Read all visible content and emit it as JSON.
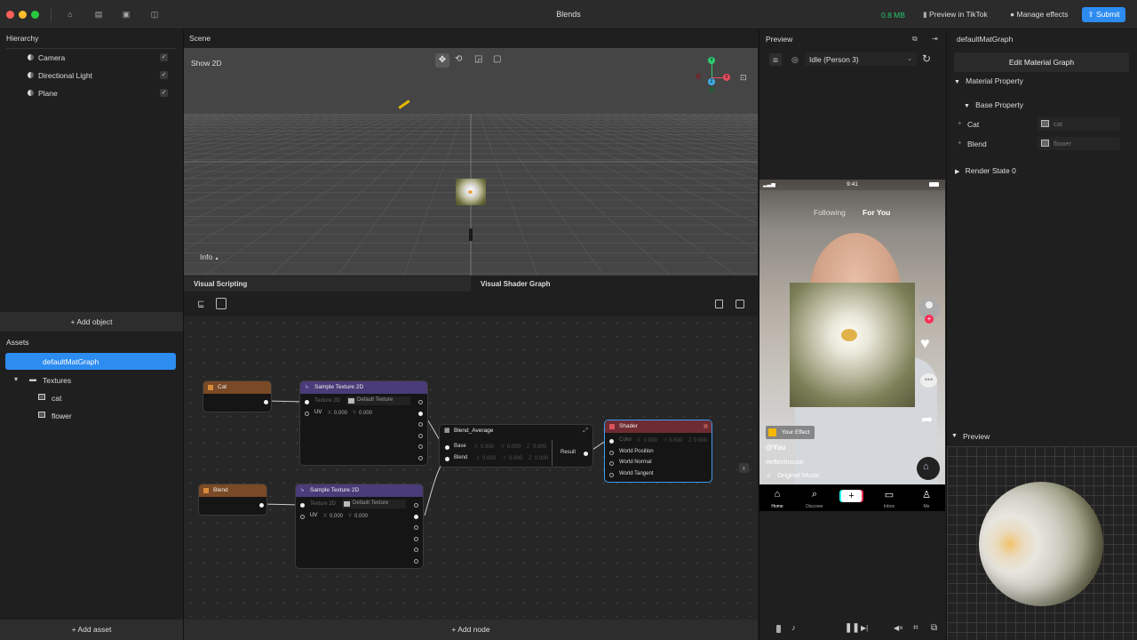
{
  "titlebar": {
    "title": "Blends",
    "file_size": "0.8 MB",
    "preview_in_tiktok": "Preview in TikTok",
    "manage_effects": "Manage effects",
    "submit": "Submit",
    "icons": [
      "home-icon",
      "document-icon",
      "archive-icon",
      "layout-icon"
    ]
  },
  "hierarchy": {
    "title": "Hierarchy",
    "items": [
      {
        "label": "Camera",
        "checked": true
      },
      {
        "label": "Directional Light",
        "checked": true
      },
      {
        "label": "Plane",
        "checked": true
      }
    ],
    "add_object": "+ Add object"
  },
  "assets": {
    "title": "Assets",
    "selected": "defaultMatGraph",
    "folder": "Textures",
    "files": [
      "cat",
      "flower"
    ],
    "add_asset": "+ Add asset"
  },
  "scene": {
    "title": "Scene",
    "show2d": "Show 2D",
    "info": "Info",
    "gizmo": {
      "y": "Y",
      "x": "X",
      "z": "Z"
    }
  },
  "graph": {
    "tabs": [
      "Visual Scripting",
      "Visual Shader Graph"
    ],
    "add_node": "+ Add node",
    "nodes": {
      "cat": {
        "title": "Cat"
      },
      "blend": {
        "title": "Blend"
      },
      "sample1": {
        "title": "Sample Texture 2D",
        "texture_label": "Texture 2D",
        "texture_value": "Default Texture",
        "uv_label": "UV",
        "x_label": "X",
        "x": "0.000",
        "y_label": "Y",
        "y": "0.000"
      },
      "sample2": {
        "title": "Sample Texture 2D",
        "texture_label": "Texture 2D",
        "texture_value": "Default Texture",
        "uv_label": "UV",
        "x_label": "X",
        "x": "0.000",
        "y_label": "Y",
        "y": "0.000"
      },
      "blend_avg": {
        "title": "Blend_Average",
        "base": "Base",
        "blend": "Blend",
        "result": "Result",
        "x_label": "X",
        "y_label": "Y",
        "z_label": "Z",
        "zero": "0.000"
      },
      "shader": {
        "title": "Shader",
        "color": "Color",
        "world_position": "World Position",
        "world_normal": "World Normal",
        "world_tangent": "World Tangent",
        "x_label": "X",
        "y_label": "Y",
        "z_label": "Z",
        "zero": "0.000"
      }
    }
  },
  "preview": {
    "title": "Preview",
    "person_select": "Idle (Person 3)",
    "phone": {
      "time": "9:41",
      "following": "Following",
      "for_you": "For You",
      "effect_badge": "Your Effect",
      "user": "@You",
      "hashtag": "#effecthouse",
      "music": "Original Music",
      "nav": [
        "Home",
        "Discover",
        "",
        "Inbox",
        "Me"
      ]
    }
  },
  "inspector": {
    "title": "defaultMatGraph",
    "edit_button": "Edit Material Graph",
    "material_property": "Material Property",
    "base_property": "Base Property",
    "props": [
      {
        "label": "Cat",
        "value": "cat"
      },
      {
        "label": "Blend",
        "value": "flower"
      }
    ],
    "render_state": "Render State 0",
    "preview_title": "Preview"
  },
  "colors": {
    "accent": "#2d8cf0",
    "file_size_green": "#28c76f",
    "texture_node_header": "#7a4a26",
    "sample_node_header": "#4a3c78",
    "shader_node_header": "#7a2e34"
  }
}
